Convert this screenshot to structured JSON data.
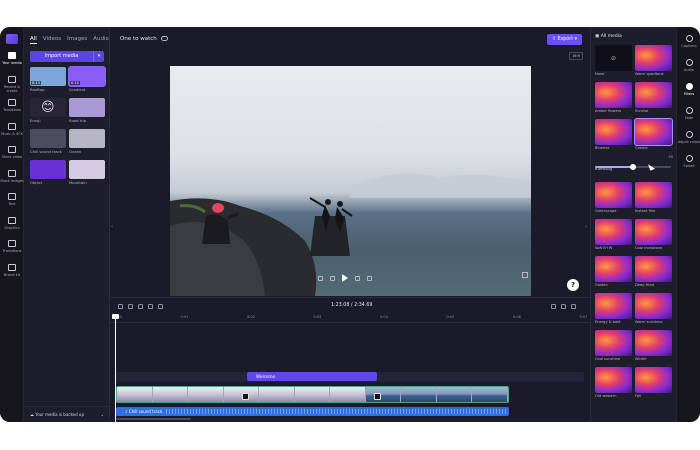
{
  "left_rail": {
    "items": [
      {
        "label": "Your media",
        "icon": "folder-icon",
        "active": true
      },
      {
        "label": "Record & create",
        "icon": "camera-icon"
      },
      {
        "label": "Templates",
        "icon": "templates-icon"
      },
      {
        "label": "Music & SFX",
        "icon": "music-icon"
      },
      {
        "label": "Stock video",
        "icon": "video-icon"
      },
      {
        "label": "Stock images",
        "icon": "image-icon"
      },
      {
        "label": "Text",
        "icon": "text-icon"
      },
      {
        "label": "Graphics",
        "icon": "graphics-icon"
      },
      {
        "label": "Transitions",
        "icon": "transitions-icon"
      },
      {
        "label": "Brand kit",
        "icon": "brand-kit-icon"
      }
    ]
  },
  "media_panel": {
    "tabs": [
      "All",
      "Videos",
      "Images",
      "Audio"
    ],
    "active_tab": "All",
    "import_label": "Import media",
    "items": [
      {
        "label": "Rooftop",
        "badge": "0:13",
        "color": "#7fa6d8",
        "selected": false
      },
      {
        "label": "Gradient",
        "badge": "0:10",
        "color": "#8b5cf6",
        "selected": true
      },
      {
        "label": "Emoji",
        "badge": "",
        "color": "#2a2438",
        "selected": false
      },
      {
        "label": "Road trip",
        "badge": "",
        "color": "#a89ad6",
        "selected": false
      },
      {
        "label": "Chill sound track",
        "badge": "",
        "color": "#4a4d62",
        "selected": false
      },
      {
        "label": "Ocean",
        "badge": "",
        "color": "#b8b6c4",
        "selected": false
      },
      {
        "label": "Object",
        "badge": "",
        "color": "#6b2fd6",
        "selected": false
      },
      {
        "label": "Mountain",
        "badge": "",
        "color": "#d2cbe3",
        "selected": false
      }
    ],
    "backup_label": "Your media is backed up"
  },
  "topbar": {
    "project_title": "One to watch",
    "export_label": "Export",
    "aspect_ratio": "16:9"
  },
  "timeline": {
    "timecode": "1:23.08 / 2:34.69",
    "ruler_ticks": [
      "0:00",
      "0:01",
      "0:02",
      "0:03",
      "0:04",
      "0:05",
      "0:06",
      "0:07"
    ],
    "text_clip": "Welcome",
    "audio_clip": "Chill sound track"
  },
  "filters_panel": {
    "header": "All media",
    "intensity_label": "Intensity",
    "intensity_value": "50",
    "intensity_fraction": 0.5,
    "items": [
      {
        "label": "None",
        "none": true
      },
      {
        "label": "Warm quadtone"
      },
      {
        "label": "Amber flowers"
      },
      {
        "label": "Sunrise"
      },
      {
        "label": "Bluerise"
      },
      {
        "label": "Cosmic",
        "selected": true
      },
      {
        "label": "Greenscape"
      },
      {
        "label": "Instant film"
      },
      {
        "label": "Soft B+W"
      },
      {
        "label": "Cool monotone"
      },
      {
        "label": "Golden"
      },
      {
        "label": "Deep fried"
      },
      {
        "label": "Energy & bold"
      },
      {
        "label": "Warm sunshine"
      },
      {
        "label": "Cool sunshine"
      },
      {
        "label": "Winter"
      },
      {
        "label": "Old western"
      },
      {
        "label": "Fall"
      }
    ]
  },
  "right_rail": {
    "items": [
      {
        "label": "Captions",
        "icon": "captions-icon"
      },
      {
        "label": "Audio",
        "icon": "audio-icon"
      },
      {
        "label": "Filters",
        "icon": "filters-icon",
        "active": true
      },
      {
        "label": "Fade",
        "icon": "fade-icon"
      },
      {
        "label": "Adjust colors",
        "icon": "adjust-colors-icon"
      },
      {
        "label": "Speed",
        "icon": "speed-icon"
      }
    ]
  },
  "help": "?"
}
